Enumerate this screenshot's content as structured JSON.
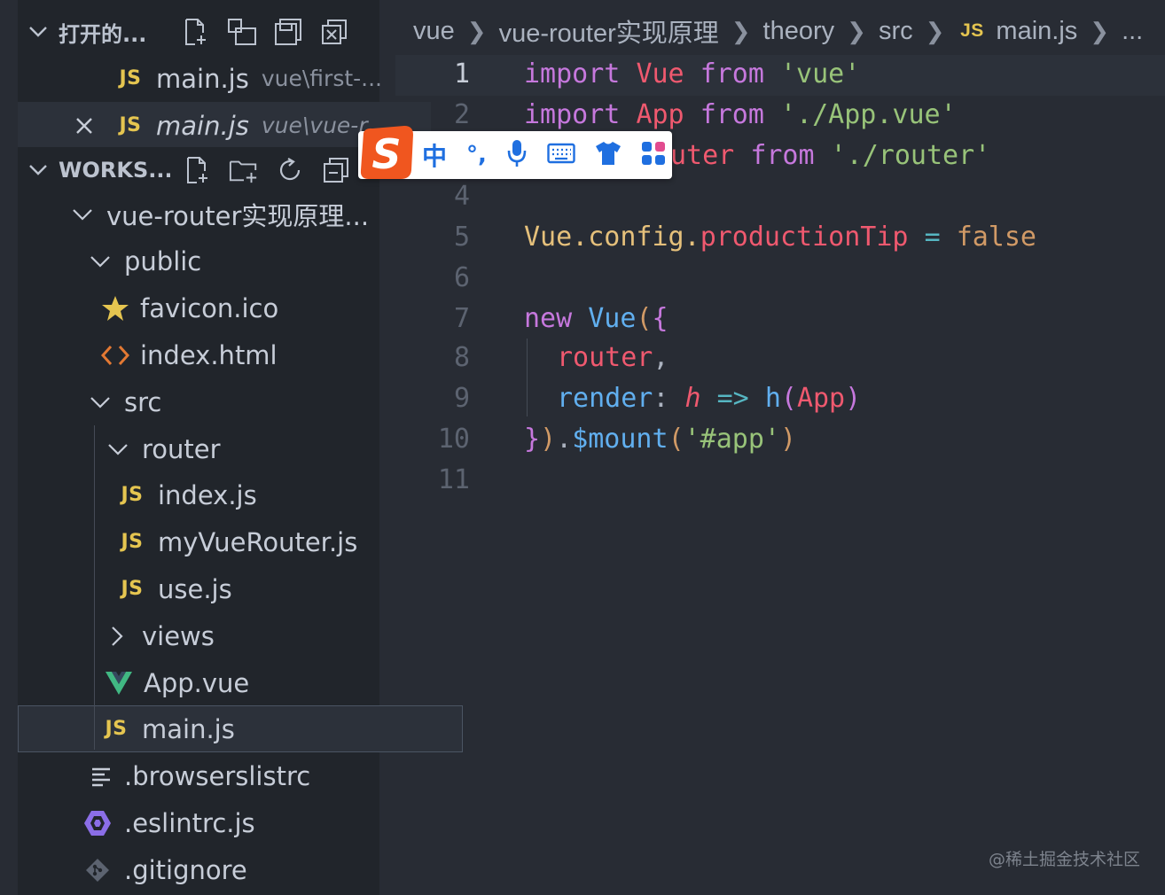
{
  "sidebar": {
    "open_editors": {
      "title": "打开的...",
      "items": [
        {
          "icon_text": "JS",
          "label": "main.js",
          "desc": "vue\\first-..."
        },
        {
          "icon_text": "JS",
          "label": "main.js",
          "desc": "vue\\vue-r..."
        }
      ]
    },
    "workspace": {
      "title": "WORKS...",
      "root": "vue-router实现原理...",
      "tree": {
        "public": "public",
        "favicon": "favicon.ico",
        "index_html": "index.html",
        "src": "src",
        "router": "router",
        "index_js": "index.js",
        "js_icon": "JS",
        "my_router": "myVueRouter.js",
        "use_js": "use.js",
        "views": "views",
        "app_vue": "App.vue",
        "main_js": "main.js",
        "browserslist": ".browserslistrc",
        "eslint": ".eslintrc.js",
        "gitignore": ".gitignore"
      }
    }
  },
  "breadcrumb": {
    "items": [
      "vue",
      "vue-router实现原理",
      "theory",
      "src",
      "main.js"
    ],
    "js_icon": "JS",
    "ellipsis": "..."
  },
  "editor": {
    "line_numbers": [
      "1",
      "2",
      "3",
      "4",
      "5",
      "6",
      "7",
      "8",
      "9",
      "10",
      "11"
    ],
    "tokens": {
      "import": "import",
      "vue_id": "Vue",
      "from": "from",
      "vue_str": "'vue'",
      "app_id": "App",
      "app_str": "'./App.vue'",
      "router_tail": "uter",
      "router_str": "'./router'",
      "vue5": "Vue",
      "config": ".config.",
      "productionTip": "productionTip",
      "eq": "=",
      "false": "false",
      "new": "new",
      "vue7": "Vue",
      "paren_open": "(",
      "brace_open": "{",
      "router_prop": "router",
      "comma": ",",
      "render": "render",
      "colon": ":",
      "h_param": "h",
      "arrow": "=>",
      "h_fn": "h",
      "app_arg": "App",
      "paren_close": ")",
      "brace_close": "}",
      "paren_close2": ")",
      "dot": ".",
      "mount": "$mount",
      "mount_open": "(",
      "app_sel": "'#app'",
      "mount_close": ")"
    }
  },
  "ime": {
    "logo": "S",
    "lang": "中",
    "punct": "°,"
  },
  "watermark": "@稀土掘金技术社区"
}
